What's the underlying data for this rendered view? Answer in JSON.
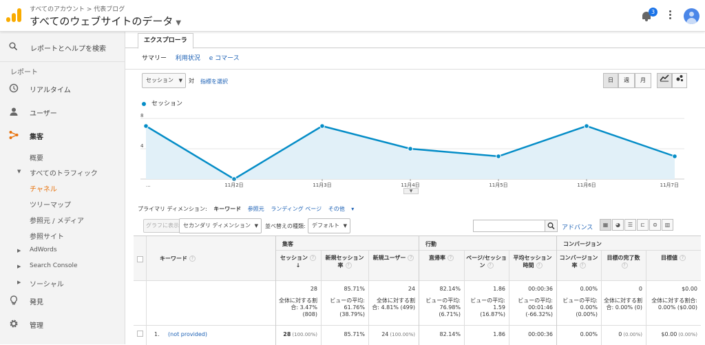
{
  "header": {
    "breadcrumb": "すべてのアカウント > 代表ブログ",
    "account": "すべてのウェブサイトのデータ",
    "notification_count": "3",
    "icons": [
      "analytics-logo",
      "bell-icon",
      "more-vert-icon",
      "avatar"
    ]
  },
  "sidebar": {
    "search": "レポートとヘルプを検索",
    "section": "レポート",
    "items": [
      {
        "label": "リアルタイム",
        "icon": "clock-icon"
      },
      {
        "label": "ユーザー",
        "icon": "person-icon"
      },
      {
        "label": "集客",
        "icon": "acquisition-icon"
      }
    ],
    "sub": {
      "overview": "概要",
      "all_traffic": "すべてのトラフィック",
      "channel": "チャネル",
      "treemap": "ツリーマップ",
      "source_medium": "参照元 / メディア",
      "referral": "参照サイト",
      "adwords": "AdWords",
      "search_console": "Search Console",
      "social": "ソーシャル"
    },
    "bottom": [
      {
        "label": "発見",
        "icon": "lightbulb-icon"
      },
      {
        "label": "管理",
        "icon": "gear-icon"
      }
    ]
  },
  "explorer": {
    "tab": "エクスプローラ",
    "subtabs": [
      "サマリー",
      "利用状況",
      "e コマース"
    ],
    "metric_select": "セッション",
    "vs": "対",
    "choose_metric": "指標を選択",
    "granularity": [
      "日",
      "週",
      "月"
    ],
    "legend": "セッション"
  },
  "chart_data": {
    "type": "line",
    "x": [
      "...",
      "11月2日",
      "11月3日",
      "11月4日",
      "11月5日",
      "11月6日",
      "11月7日"
    ],
    "series": [
      {
        "name": "セッション",
        "values": [
          7,
          0,
          7,
          4,
          3,
          7,
          3
        ]
      }
    ],
    "yticks": [
      4,
      8
    ],
    "ylim": [
      0,
      8
    ],
    "color": "#058dc7"
  },
  "dimensions": {
    "label": "プライマリ ディメンション:",
    "items": [
      "キーワード",
      "参照元",
      "ランディング ページ",
      "その他"
    ]
  },
  "toolbar": {
    "graph_btn": "グラフに表示",
    "secondary": "セカンダリ ディメンション",
    "sort_label": "並べ替えの種類:",
    "sort_value": "デフォルト",
    "advanced": "アドバンス"
  },
  "table": {
    "col_keyword": "キーワード",
    "groups": [
      "集客",
      "行動",
      "コンバージョン"
    ],
    "headers": [
      "セッション",
      "新規セッション率",
      "新規ユーザー",
      "直帰率",
      "ページ/セッション",
      "平均セッション時間",
      "コンバージョン率",
      "目標の完了数",
      "目標値"
    ],
    "totals": [
      {
        "value": "28",
        "sub": "全体に対する割合: 3.47% (808)"
      },
      {
        "value": "85.71%",
        "sub": "ビューの平均: 61.76% (38.79%)"
      },
      {
        "value": "24",
        "sub": "全体に対する割合: 4.81% (499)"
      },
      {
        "value": "82.14%",
        "sub": "ビューの平均: 76.98% (6.71%)"
      },
      {
        "value": "1.86",
        "sub": "ビューの平均: 1.59 (16.87%)"
      },
      {
        "value": "00:00:36",
        "sub": "ビューの平均: 00:01:46 (-66.32%)"
      },
      {
        "value": "0.00%",
        "sub": "ビューの平均: 0.00% (0.00%)"
      },
      {
        "value": "0",
        "sub": "全体に対する割合: 0.00% (0)"
      },
      {
        "value": "$0.00",
        "sub": "全体に対する割合: 0.00% ($0.00)"
      }
    ],
    "rows": [
      {
        "index": "1.",
        "keyword": "(not provided)",
        "cells": [
          "28",
          "(100.00%)",
          "85.71%",
          "24",
          "(100.00%)",
          "82.14%",
          "1.86",
          "00:00:36",
          "0.00%",
          "0",
          "(0.00%)",
          "$0.00",
          "(0.00%)"
        ]
      }
    ]
  }
}
